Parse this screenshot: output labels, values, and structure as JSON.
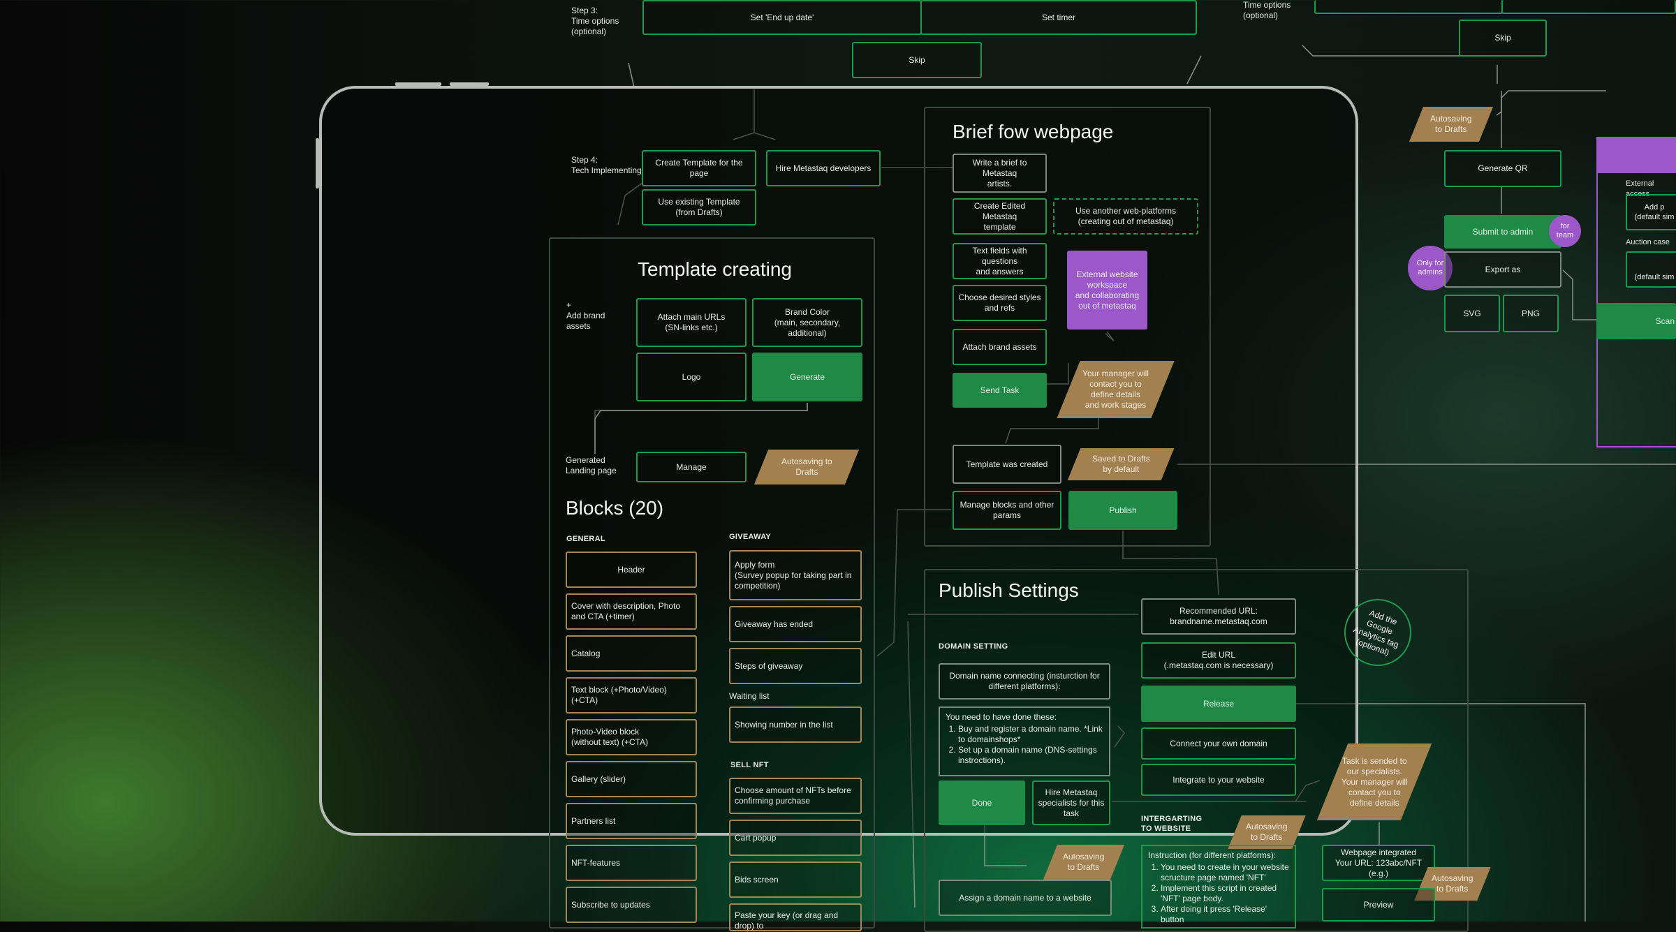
{
  "colors": {
    "accent_green": "#1e8a45",
    "purple": "#9c57c9",
    "tan": "#a2804f",
    "border_gray": "#7d8a82"
  },
  "top": {
    "step3_label": "Step 3:\nTime options\n(optional)",
    "end_date_button": "Set 'End up date'",
    "set_timer_button": "Set timer",
    "skip_button": "Skip",
    "right_time_options": "Time options\n(optional)",
    "right_skip_button": "Skip"
  },
  "step4": {
    "label": "Step 4:\nTech Implementing",
    "create_template": "Create Template for the page",
    "hire_developers": "Hire Metastaq developers",
    "use_existing": "Use existing Template\n(from Drafts)"
  },
  "template": {
    "title": "Template creating",
    "add_brand_assets": "+\nAdd brand\nassets",
    "attach_urls": "Attach main URLs\n(SN-links etc.)",
    "brand_color": "Brand Color\n(main, secondary,\nadditional)",
    "logo": "Logo",
    "generate": "Generate",
    "generated_landing": "Generated\nLanding page",
    "manage": "Manage",
    "autosaving": "Autosaving to\nDrafts"
  },
  "blocks": {
    "title": "Blocks (20)",
    "general_label": "GENERAL",
    "general": [
      "Header",
      "Cover with description, Photo and CTA (+timer)",
      "Catalog",
      "Text block (+Photo/Video) (+CTA)",
      "Photo-Video block\n(without text) (+CTA)",
      "Gallery (slider)",
      "Partners list",
      "NFT-features",
      "Subscribe to updates"
    ],
    "giveaway_label": "GIVEAWAY",
    "giveaway": [
      "Apply form\n(Survey popup for taking part in competition)",
      "Giveaway has ended",
      "Steps of giveaway"
    ],
    "waiting_label": "Waiting list",
    "waiting": [
      "Showing number in the list"
    ],
    "sell_label": "SELL NFT",
    "sell": [
      "Choose amount of NFTs before confirming purchase",
      "Cart popup",
      "Bids screen",
      "Paste your key (or drag and drop) to"
    ]
  },
  "brief": {
    "title": "Brief fow webpage",
    "write_brief": "Write a brief to Metastaq\nartists.",
    "create_edited": "Create Edited Metastaq\ntemplate",
    "use_another": "Use another web-platforms\n(creating out of metastaq)",
    "text_fields": "Text fields with questions\nand answers",
    "external_workspace": "External website\nworkspace\nand collaborating\nout of metastaq",
    "choose_styles": "Choose desired styles\nand refs",
    "attach_assets": "Attach brand assets",
    "send_task": "Send Task",
    "manager_contact": "Your manager will\ncontact you to\ndefine details\nand work stages",
    "template_created": "Template was created",
    "saved_drafts": "Saved to Drafts\nby default",
    "manage_blocks": "Manage blocks and other\nparams",
    "publish": "Publish"
  },
  "publish": {
    "title": "Publish Settings",
    "recommended_url": "Recommended URL:\nbrandname.metastaq.com",
    "domain_label": "DOMAIN SETTING",
    "edit_url": "Edit URL\n(.metastaq.com is necessary)",
    "domain_connecting": "Domain name connecting (insturction for\ndifferent platforms):",
    "release": "Release",
    "todo_intro": "You need to have done these:",
    "todo_items": [
      "Buy and register a domain name. *Link to domainshops*",
      "Set up a domain name (DNS-settings instroctions)."
    ],
    "connect_domain": "Connect your own domain",
    "integrate": "Integrate to your website",
    "done": "Done",
    "hire_specialists": "Hire Metastaq\nspecialists for this\ntask",
    "integrating_label": "INTERGARTING\nTO WEBSITE",
    "autosaving_1": "Autosaving\nto Drafts",
    "autosaving_2": "Autosaving\nto Drafts",
    "assign_domain": "Assign a domain name to a website",
    "instruction_intro": "Instruction (for different platforms):",
    "instruction_items": [
      "You need to create in your website scructure page named 'NFT'",
      "Implement this script in created 'NFT' page body.",
      "After doing it press 'Release' button"
    ],
    "task_sended": "Task is sended to\nour specialists.\nYour manager will\ncontact you to\ndefine details",
    "webpage_integrated": "Webpage integrated\nYour URL: 123abc/NFT (e.g.)",
    "autosaving_3": "Autosaving\nto Drafts",
    "preview": "Preview",
    "google_analytics": "Add the\nGoogle\nAnalytics tag\n(optional)"
  },
  "right": {
    "autosaving": "Autosaving\nto Drafts",
    "generate_qr": "Generate QR",
    "submit_admin": "Submit to admin",
    "for_team": "for\nteam",
    "only_admins": "Only for\nadmins",
    "export_as": "Export as",
    "svg": "SVG",
    "png": "PNG",
    "external_access": "External access",
    "add_p": "Add p",
    "default_sim_1": "(default sim",
    "auction_case": "Auction case",
    "default_sim_2": "(default sim",
    "scan": "Scan"
  }
}
